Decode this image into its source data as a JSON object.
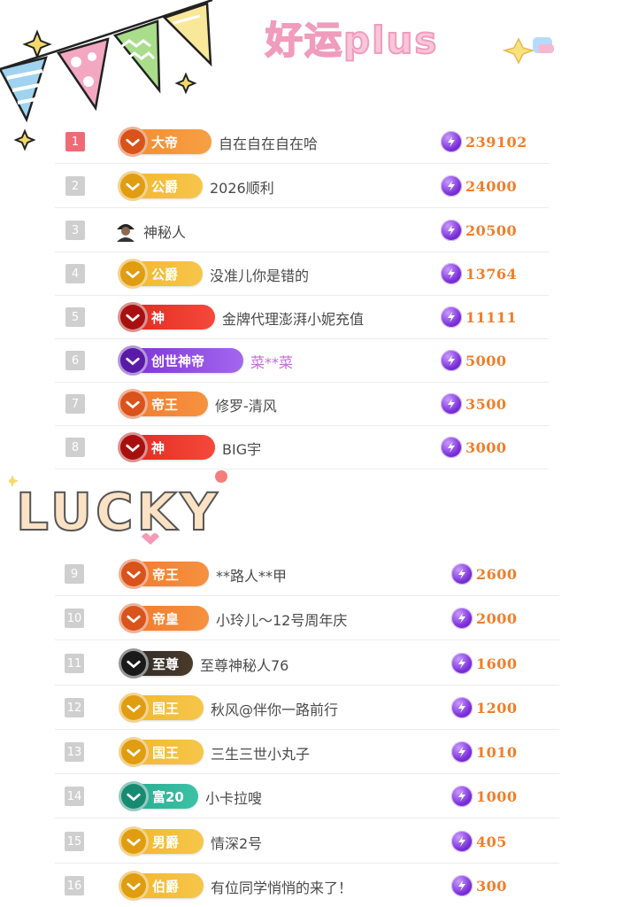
{
  "header": {
    "title": "好运plus"
  },
  "divider": {
    "text": "LUCKY"
  },
  "colors": {
    "score": "#ef7e2a",
    "rank_top": "#f06a76",
    "rank_default": "#cfcfcf",
    "name": "#4a4a4a",
    "name_highlight": "#c36ad8"
  },
  "entries": [
    {
      "rank": "1",
      "badge": "大帝",
      "name": "自在自在自在哈",
      "score": "239102",
      "icon": "emperor-emblem-icon"
    },
    {
      "rank": "2",
      "badge": "公爵",
      "name": "2026顺利",
      "score": "24000",
      "icon": "duke-emblem-icon"
    },
    {
      "rank": "3",
      "badge": "",
      "name": "神秘人",
      "score": "20500",
      "icon": "mystery-avatar-icon"
    },
    {
      "rank": "4",
      "badge": "公爵",
      "name": "没准儿你是错的",
      "score": "13764",
      "icon": "duke-emblem-icon"
    },
    {
      "rank": "5",
      "badge": "神",
      "name": "金牌代理澎湃小妮充值",
      "score": "11111",
      "icon": "god-emblem-icon"
    },
    {
      "rank": "6",
      "badge": "创世神帝",
      "name": "菜**菜",
      "score": "5000",
      "icon": "creator-emblem-icon"
    },
    {
      "rank": "7",
      "badge": "帝王",
      "name": "修罗-清风",
      "score": "3500",
      "icon": "monarch-emblem-icon"
    },
    {
      "rank": "8",
      "badge": "神",
      "name": "BIG宇",
      "score": "3000",
      "icon": "god-emblem-icon"
    },
    {
      "rank": "9",
      "badge": "帝王",
      "name": "**路人**甲",
      "score": "2600",
      "icon": "monarch-emblem-icon"
    },
    {
      "rank": "10",
      "badge": "帝皇",
      "name": "小玲儿～12号周年庆",
      "score": "2000",
      "icon": "emperor-emblem-icon"
    },
    {
      "rank": "11",
      "badge": "至尊",
      "name": "至尊神秘人76",
      "score": "1600",
      "icon": "supreme-badge-icon"
    },
    {
      "rank": "12",
      "badge": "国王",
      "name": "秋风@伴你一路前行",
      "score": "1200",
      "icon": "king-emblem-icon"
    },
    {
      "rank": "13",
      "badge": "国王",
      "name": "三生三世小丸子",
      "score": "1010",
      "icon": "king-emblem-icon"
    },
    {
      "rank": "14",
      "badge": "富20",
      "name": "小卡拉嗖",
      "score": "1000",
      "icon": "wealth-emblem-icon"
    },
    {
      "rank": "15",
      "badge": "男爵",
      "name": "情深2号",
      "score": "405",
      "icon": "baron-emblem-icon"
    },
    {
      "rank": "16",
      "badge": "伯爵",
      "name": "有位同学悄悄的来了！",
      "score": "300",
      "icon": "earl-emblem-icon"
    }
  ]
}
